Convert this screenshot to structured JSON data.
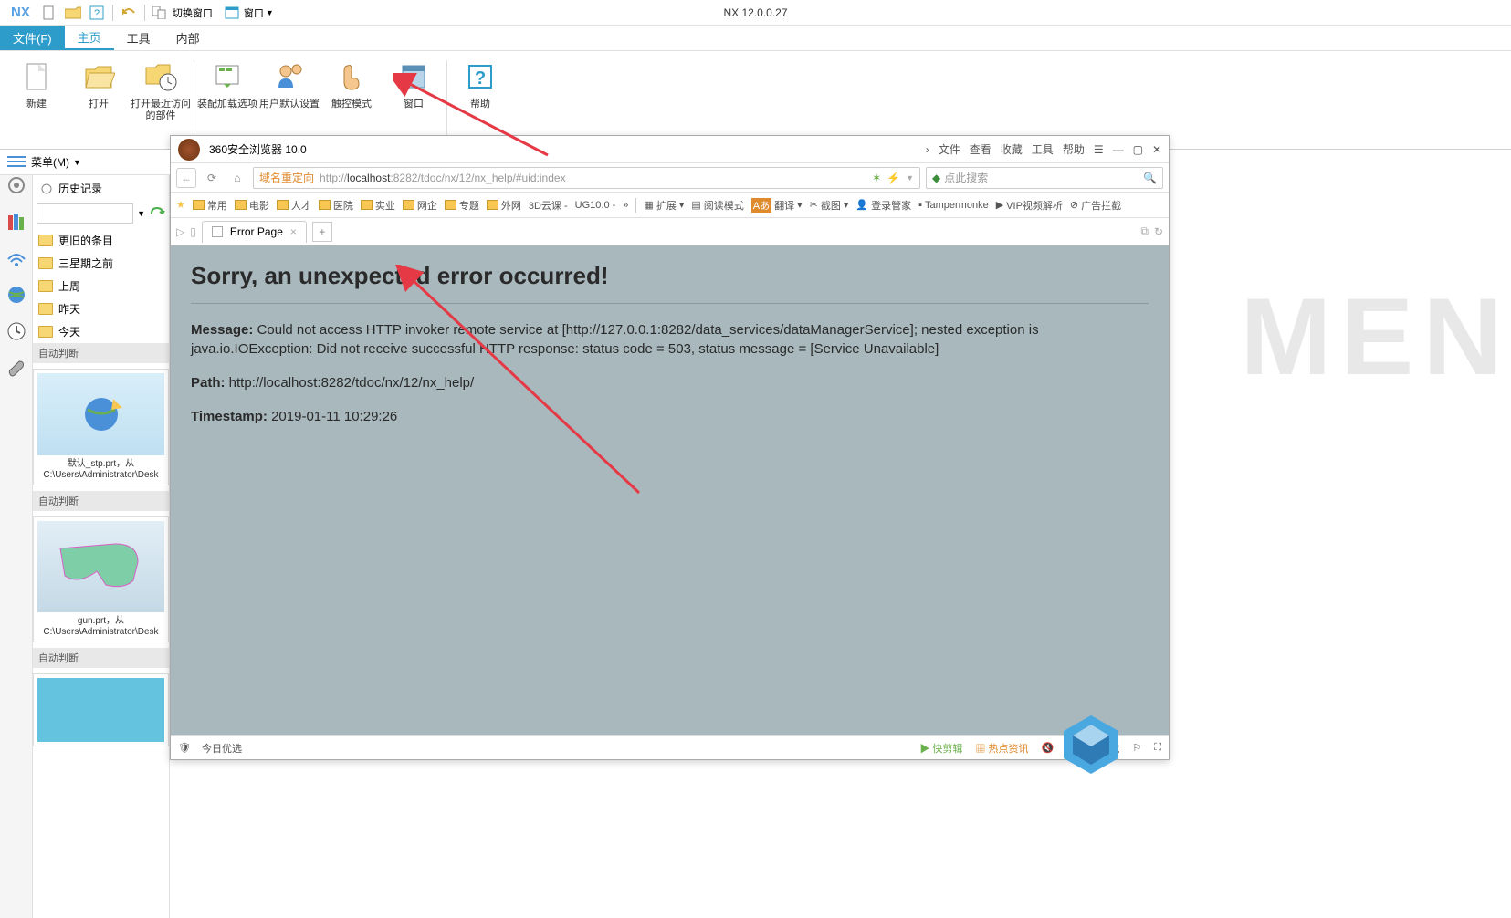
{
  "app": {
    "title": "NX 12.0.0.27",
    "logo": "NX"
  },
  "qat": {
    "switch_window": "切换窗口",
    "window": "窗口"
  },
  "ribbon_tabs": {
    "file": "文件(F)",
    "home": "主页",
    "tools": "工具",
    "internal": "内部"
  },
  "ribbon": {
    "new": "新建",
    "open": "打开",
    "open_recent": "打开最近访问的部件",
    "assembly_load": "装配加载选项",
    "user_defaults": "用户默认设置",
    "touch_mode": "触控模式",
    "window": "窗口",
    "help": "帮助"
  },
  "menu": {
    "label": "菜单(M)"
  },
  "history": {
    "title": "历史记录",
    "older": "更旧的条目",
    "three_weeks": "三星期之前",
    "last_week": "上周",
    "yesterday": "昨天",
    "today": "今天",
    "auto_detect": "自动判断",
    "item1_name": "默认_stp.prt，从",
    "item1_path": "C:\\Users\\Administrator\\Desk",
    "item2_name": "gun.prt，从",
    "item2_path": "C:\\Users\\Administrator\\Desk"
  },
  "browser": {
    "title": "360安全浏览器 10.0",
    "title_menu": {
      "file": "文件",
      "view": "查看",
      "fav": "收藏",
      "tools": "工具",
      "help": "帮助"
    },
    "addr_redirect": "域名重定向",
    "url_prefix": "http://",
    "url_host": "localhost",
    "url_rest": ":8282/tdoc/nx/12/nx_help/#uid:index",
    "search_placeholder": "点此搜索",
    "bookmarks": {
      "common": "常用",
      "movie": "电影",
      "talent": "人才",
      "hospital": "医院",
      "industry": "实业",
      "netent": "网企",
      "special": "专题",
      "external": "外网",
      "cloud3d": "3D云课 -",
      "ug": "UG10.0 -",
      "ext": "扩展",
      "read": "阅读模式",
      "trans": "翻译",
      "shot": "截图",
      "login": "登录管家",
      "tm": "Tampermonke",
      "vip": "VIP视频解析",
      "adblock": "广告拦截"
    },
    "tab_label": "Error Page",
    "error": {
      "heading": "Sorry, an unexpected error occurred!",
      "msg_label": "Message:",
      "msg_text": "Could not access HTTP invoker remote service at [http://127.0.0.1:8282/data_services/dataManagerService]; nested exception is java.io.IOException: Did not receive successful HTTP response: status code = 503, status message = [Service Unavailable]",
      "path_label": "Path:",
      "path_text": "http://localhost:8282/tdoc/nx/12/nx_help/",
      "ts_label": "Timestamp:",
      "ts_text": "2019-01-11 10:29:26"
    },
    "status": {
      "today": "今日优选",
      "clip": "快剪辑",
      "hot": "热点资讯",
      "dl": "下载"
    }
  }
}
